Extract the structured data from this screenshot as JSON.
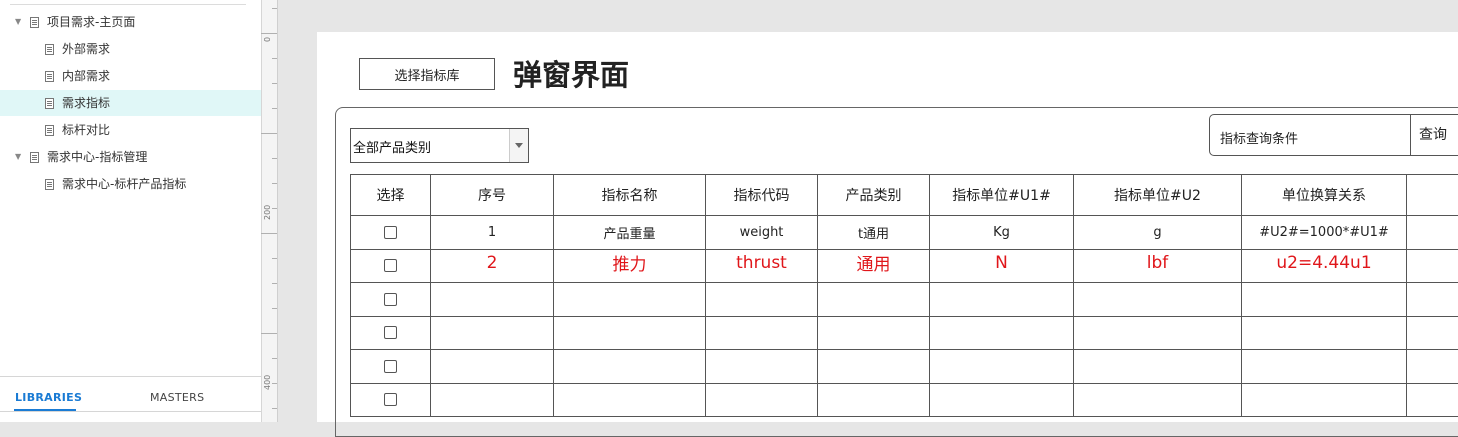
{
  "pages_panel": {
    "items": [
      {
        "label": "项目需求-主页面",
        "level": 0,
        "expanded": true,
        "selected": false
      },
      {
        "label": "外部需求",
        "level": 1,
        "selected": false
      },
      {
        "label": "内部需求",
        "level": 1,
        "selected": false
      },
      {
        "label": "需求指标",
        "level": 1,
        "selected": true
      },
      {
        "label": "标杆对比",
        "level": 1,
        "selected": false
      },
      {
        "label": "需求中心-指标管理",
        "level": 0,
        "expanded": true,
        "selected": false
      },
      {
        "label": "需求中心-标杆产品指标",
        "level": 1,
        "selected": false
      }
    ],
    "tabs": [
      "LIBRARIES",
      "MASTERS"
    ],
    "active_tab": "LIBRARIES",
    "accent_color": "#1a7bd4",
    "selected_bg": "#e0f7f7"
  },
  "ruler": {
    "labels": [
      "0",
      "200",
      "400"
    ]
  },
  "canvas": {
    "select_lib_button": "选择指标库",
    "title": "弹窗界面",
    "category_select": {
      "value": "全部产品类别"
    },
    "query": {
      "label": "指标查询条件",
      "button": "查询"
    },
    "table": {
      "headers": [
        "选择",
        "序号",
        "指标名称",
        "指标代码",
        "产品类别",
        "指标单位#U1#",
        "指标单位#U2",
        "单位换算关系",
        ""
      ],
      "rows": [
        {
          "checkbox": true,
          "cells": [
            "1",
            "产品重量",
            "weight",
            "t通用",
            "Kg",
            "g",
            "#U2#=1000*#U1#",
            ""
          ],
          "red": false
        },
        {
          "checkbox": true,
          "cells": [
            "2",
            "推力",
            "thrust",
            "通用",
            "N",
            "lbf",
            "u2=4.44u1",
            ""
          ],
          "red": true
        },
        {
          "checkbox": true,
          "cells": [
            "",
            "",
            "",
            "",
            "",
            "",
            "",
            ""
          ],
          "red": false
        },
        {
          "checkbox": true,
          "cells": [
            "",
            "",
            "",
            "",
            "",
            "",
            "",
            ""
          ],
          "red": false
        },
        {
          "checkbox": true,
          "cells": [
            "",
            "",
            "",
            "",
            "",
            "",
            "",
            ""
          ],
          "red": false
        },
        {
          "checkbox": true,
          "cells": [
            "",
            "",
            "",
            "",
            "",
            "",
            "",
            ""
          ],
          "red": false
        }
      ],
      "red_color": "#e0161a"
    }
  }
}
